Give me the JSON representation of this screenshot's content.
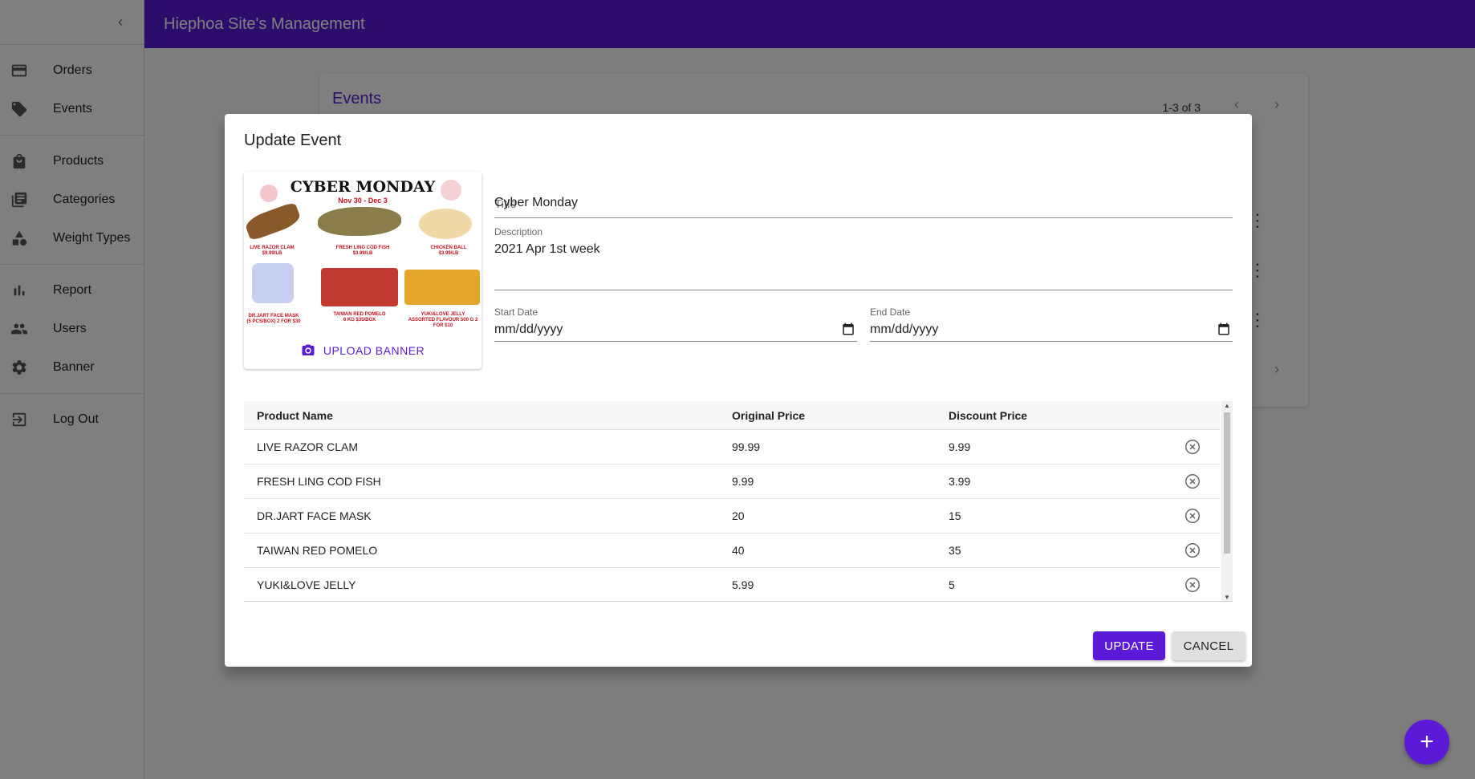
{
  "app": {
    "title": "Hiephoa Site's Management"
  },
  "sidebar": {
    "groups": [
      [
        {
          "label": "Orders",
          "icon": "credit-card-icon"
        },
        {
          "label": "Events",
          "icon": "tag-icon"
        }
      ],
      [
        {
          "label": "Products",
          "icon": "shopping-bag-icon"
        },
        {
          "label": "Categories",
          "icon": "library-books-icon"
        },
        {
          "label": "Weight Types",
          "icon": "category-shapes-icon"
        }
      ],
      [
        {
          "label": "Report",
          "icon": "bar-chart-icon"
        },
        {
          "label": "Users",
          "icon": "people-icon"
        },
        {
          "label": "Banner",
          "icon": "gear-icon"
        }
      ],
      [
        {
          "label": "Log Out",
          "icon": "exit-icon"
        }
      ]
    ]
  },
  "events_card": {
    "title": "Events",
    "pagination": "1-3 of 3"
  },
  "dialog": {
    "title": "Update Event",
    "banner": {
      "headline": "CYBER MONDAY",
      "dates": "Nov 30 - Dec 3",
      "items": [
        {
          "name": "LIVE RAZOR CLAM",
          "price": "$9.99/LB"
        },
        {
          "name": "FRESH LING COD FISH",
          "price": "$3.99/LB"
        },
        {
          "name": "CHICKEN BALL",
          "price": "$3.99/LB"
        },
        {
          "name": "DR.JART FACE MASK",
          "price": "(5 PCS/BOX) 2 FOR $30"
        },
        {
          "name": "TAIWAN RED POMELO",
          "price": "6 KG $35/BOX"
        },
        {
          "name": "YUKI&LOVE JELLY",
          "price": "ASSORTED FLAVOUR 500 G 2 FOR $10"
        }
      ],
      "upload_label": "UPLOAD BANNER"
    },
    "title_field": {
      "label": "Title",
      "value": "Cyber Monday"
    },
    "description_field": {
      "label": "Description",
      "value": "2021 Apr 1st week"
    },
    "start_date": {
      "label": "Start Date",
      "value": "mm/dd/yyyy"
    },
    "end_date": {
      "label": "End Date",
      "value": "mm/dd/yyyy"
    },
    "table": {
      "headers": [
        "Product Name",
        "Original Price",
        "Discount Price"
      ],
      "rows": [
        [
          "LIVE RAZOR CLAM",
          "99.99",
          "9.99"
        ],
        [
          "FRESH LING COD FISH",
          "9.99",
          "3.99"
        ],
        [
          "DR.JART FACE MASK",
          "20",
          "15"
        ],
        [
          "TAIWAN RED POMELO",
          "40",
          "35"
        ],
        [
          "YUKI&LOVE JELLY",
          "5.99",
          "5"
        ]
      ]
    },
    "buttons": {
      "update": "UPDATE",
      "cancel": "CANCEL"
    }
  },
  "colors": {
    "primary": "#5a1ad8",
    "overlay": "rgba(0,0,0,0.5)"
  }
}
